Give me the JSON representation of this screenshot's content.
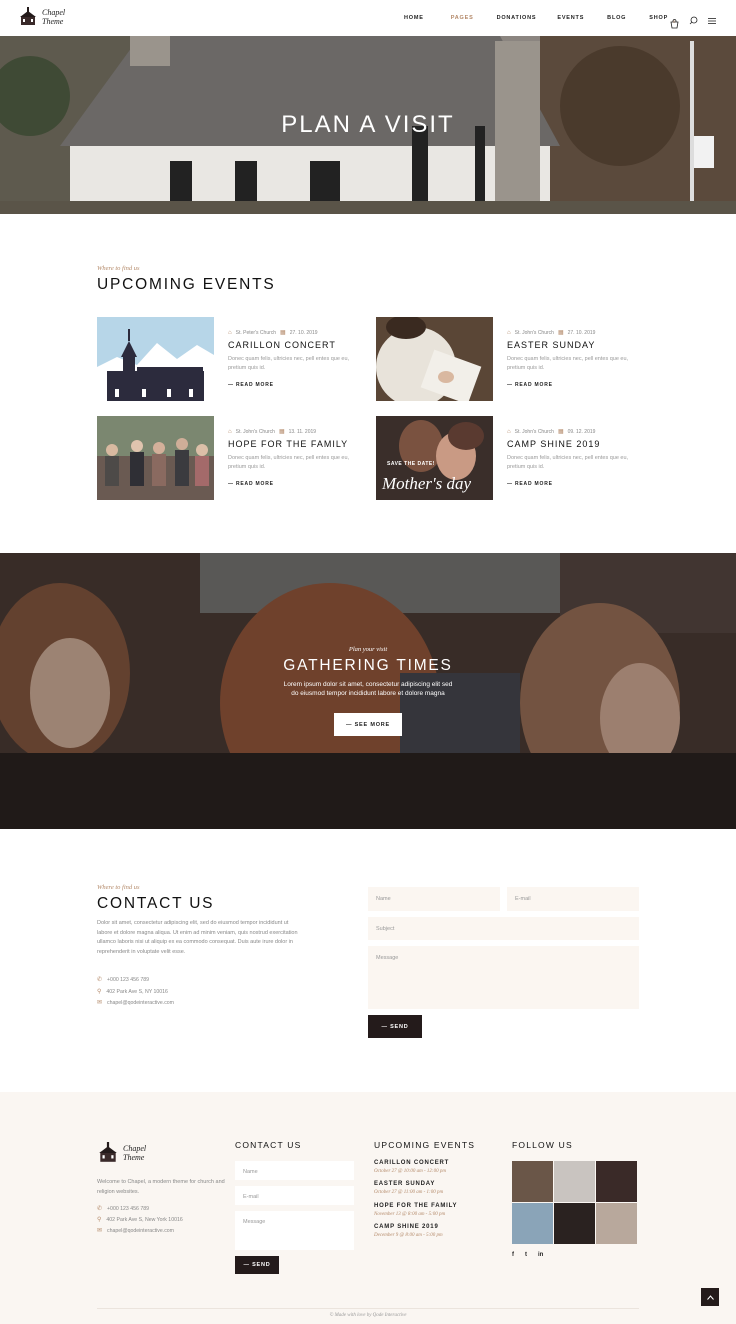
{
  "header": {
    "logo_line1": "Chapel",
    "logo_line2": "Theme",
    "nav": [
      "HOME",
      "PAGES",
      "DONATIONS",
      "EVENTS",
      "BLOG",
      "SHOP"
    ],
    "active_nav": "PAGES",
    "cart_count": "0"
  },
  "hero": {
    "title": "PLAN A VISIT"
  },
  "events_section": {
    "kicker": "Where to find us",
    "title": "UPCOMING EVENTS",
    "items": [
      {
        "place": "St. Peter's Church",
        "date": "27. 10. 2019",
        "title": "CARILLON CONCERT",
        "text": "Donec quam felis, ultricies nec, pell entes que eu, pretium quis id.",
        "more": "READ MORE"
      },
      {
        "place": "St. John's Church",
        "date": "27. 10. 2019",
        "title": "EASTER SUNDAY",
        "text": "Donec quam felis, ultricies nec, pell entes que eu, pretium quis id.",
        "more": "READ MORE"
      },
      {
        "place": "St. John's Church",
        "date": "13. 11. 2019",
        "title": "HOPE FOR THE FAMILY",
        "text": "Donec quam felis, ultricies nec, pell entes que eu, pretium quis id.",
        "more": "READ MORE"
      },
      {
        "place": "St. John's Church",
        "date": "09. 12. 2019",
        "title": "CAMP SHINE 2019",
        "text": "Donec quam felis, ultricies nec, pell entes que eu, pretium quis id.",
        "more": "READ MORE"
      }
    ],
    "card_overlay_small": "SAVE THE DATE!",
    "card_overlay_script": "Mother's day"
  },
  "gathering": {
    "kicker": "Plan your visit",
    "title": "GATHERING TIMES",
    "text1": "Lorem ipsum dolor sit amet, consectetur adipiscing elit sed",
    "text2": "do eiusmod tempor incididunt labore et dolore magna",
    "button": "SEE MORE"
  },
  "contact": {
    "kicker": "Where to find us",
    "title": "CONTACT US",
    "paragraph": "Dolor sit amet, consectetur adipiscing elit, sed do eiusmod tempor incididunt ut labore et dolore magna aliqua. Ut enim ad minim veniam, quis nostrud exercitation ullamco laboris nisi ut aliquip ex ea commodo consequat. Duis aute irure dolor in reprehenderit in voluptate velit esse.",
    "phone": "+000 123 456 789",
    "address": "402 Park Ave S, NY 10016",
    "email": "chapel@qodeinteractive.com",
    "form": {
      "name": "Name",
      "email": "E-mail",
      "subject": "Subject",
      "message": "Message",
      "send": "SEND"
    }
  },
  "footer": {
    "logo_line1": "Chapel",
    "logo_line2": "Theme",
    "about": "Welcome to Chapel, a modern theme for church and religion websites.",
    "phone": "+000 123 456 789",
    "address": "402 Park Ave S, New York 10016",
    "email": "chapel@qodeinteractive.com",
    "contact_title": "CONTACT US",
    "form": {
      "name": "Name",
      "email": "E-mail",
      "message": "Message",
      "send": "SEND"
    },
    "events_title": "UPCOMING EVENTS",
    "events": [
      {
        "title": "CARILLON CONCERT",
        "date": "October 27 @ 10:00 am - 12:00 pm"
      },
      {
        "title": "EASTER SUNDAY",
        "date": "October 27 @ 11:00 am - 1:00 pm"
      },
      {
        "title": "HOPE FOR THE FAMILY",
        "date": "November 13 @ 8:00 am - 5:00 pm"
      },
      {
        "title": "CAMP SHINE 2019",
        "date": "December 9 @ 8:00 am - 5:00 pm"
      }
    ],
    "follow_title": "FOLLOW US",
    "social": [
      "f",
      "t",
      "in"
    ],
    "copyright": "© Made with love by Qode Interactive"
  },
  "colors": {
    "accent": "#b48a6a",
    "dark": "#241b1b",
    "footer_bg": "#faf6f2",
    "field_bg": "#fbf6f1"
  }
}
